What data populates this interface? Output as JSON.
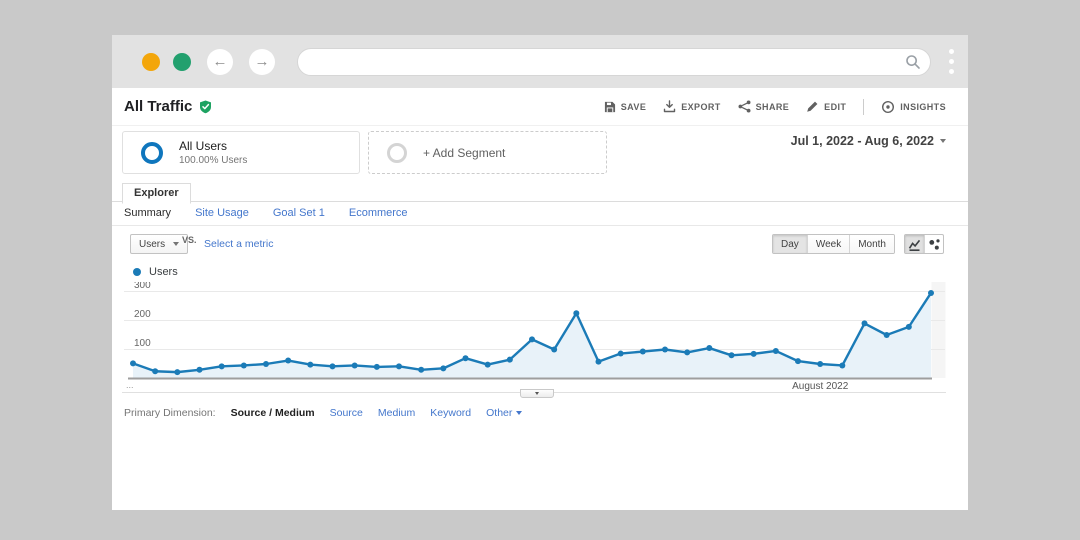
{
  "colors": {
    "accent_blue": "#1b7bb7",
    "link_blue": "#4477cc",
    "verified_green": "#1ea362",
    "traffic_dot_yellow": "#F3A60B",
    "traffic_dot_green": "#22A06E"
  },
  "chrome": {
    "url_value": "",
    "search_icon": "magnifier",
    "menu_icon": "kebab-dots"
  },
  "header": {
    "title": "All Traffic",
    "actions": [
      {
        "label": "SAVE",
        "icon": "save-icon"
      },
      {
        "label": "EXPORT",
        "icon": "export-icon"
      },
      {
        "label": "SHARE",
        "icon": "share-icon"
      },
      {
        "label": "EDIT",
        "icon": "edit-icon"
      },
      {
        "label": "INSIGHTS",
        "icon": "insights-icon"
      }
    ]
  },
  "segments": {
    "primary": {
      "title": "All Users",
      "subtitle": "100.00% Users"
    },
    "add_label": "+ Add Segment",
    "date_range": "Jul 1, 2022 - Aug 6, 2022"
  },
  "explorer": {
    "tab_label": "Explorer",
    "subtabs": [
      {
        "label": "Summary",
        "active": true
      },
      {
        "label": "Site Usage",
        "active": false
      },
      {
        "label": "Goal Set 1",
        "active": false
      },
      {
        "label": "Ecommerce",
        "active": false
      }
    ]
  },
  "controls": {
    "metric": "Users",
    "vs_label": "VS.",
    "compare_label": "Select a metric",
    "granularity": [
      {
        "label": "Day",
        "active": true
      },
      {
        "label": "Week",
        "active": false
      },
      {
        "label": "Month",
        "active": false
      }
    ]
  },
  "legend": {
    "series_label": "Users"
  },
  "chart_data": {
    "type": "line",
    "x_description": "Daily values, Jul 1 2022 to Aug 6 2022, 37 points",
    "x_axis_annotation": "August 2022",
    "x_overflow_indicator": "...",
    "annotation_point_index": 31,
    "yticks": [
      100,
      200,
      300
    ],
    "ylim": [
      0,
      330
    ],
    "grid": "horizontal",
    "legend_position": "top-left",
    "fill_color": "#e8f2f9",
    "series": [
      {
        "name": "Users",
        "color": "#1b7bb7",
        "values": [
          52,
          25,
          22,
          30,
          42,
          45,
          50,
          62,
          48,
          42,
          45,
          40,
          42,
          30,
          35,
          70,
          48,
          65,
          135,
          100,
          225,
          58,
          86,
          93,
          100,
          90,
          105,
          80,
          85,
          95,
          60,
          50,
          45,
          190,
          150,
          178,
          295
        ]
      }
    ]
  },
  "primary_dimension": {
    "label": "Primary Dimension:",
    "selected": "Source / Medium",
    "links": [
      "Source",
      "Medium",
      "Keyword"
    ],
    "other_label": "Other"
  }
}
